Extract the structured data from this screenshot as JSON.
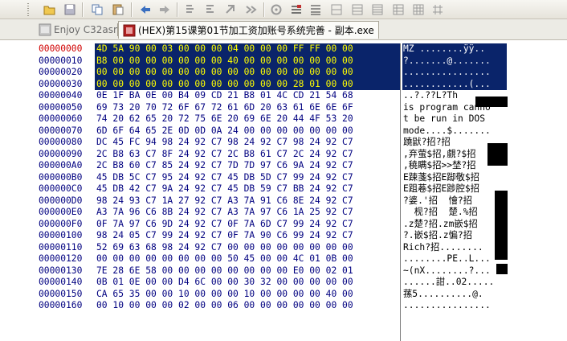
{
  "tabs": [
    {
      "label": "Enjoy C32asm"
    },
    {
      "label": "(HEX)第15课第01节加工资加账号系统完善 - 副本.exe"
    }
  ],
  "toolbar": {
    "icons": [
      "open-icon",
      "save-icon",
      "copy-icon",
      "paste-icon",
      "back-icon",
      "forward-icon",
      "jump-icon",
      "find-icon",
      "replace-icon",
      "find-next-icon",
      "goto-icon",
      "bookmark-icon",
      "column-icon",
      "split-icon",
      "grid-icon"
    ]
  },
  "hex_view": {
    "rows": [
      {
        "offset": "00000000",
        "hex": "4D 5A 90 00 03 00 00 00 04 00 00 00 FF FF 00 00",
        "ascii": "MZ ........ÿÿ..",
        "sel": true,
        "cur": true
      },
      {
        "offset": "00000010",
        "hex": "B8 00 00 00 00 00 00 00 40 00 00 00 00 00 00 00",
        "ascii": "?.......@.......",
        "sel": true
      },
      {
        "offset": "00000020",
        "hex": "00 00 00 00 00 00 00 00 00 00 00 00 00 00 00 00",
        "ascii": "................",
        "sel": true
      },
      {
        "offset": "00000030",
        "hex": "00 00 00 00 00 00 00 00 00 00 00 00 28 01 00 00",
        "ascii": "............(...",
        "sel": true
      },
      {
        "offset": "00000040",
        "hex": "0E 1F BA 0E 00 B4 09 CD 21 B8 01 4C CD 21 54 68",
        "ascii": "..?.??L?Th"
      },
      {
        "offset": "00000050",
        "hex": "69 73 20 70 72 6F 67 72 61 6D 20 63 61 6E 6E 6F",
        "ascii": "is program canno"
      },
      {
        "offset": "00000060",
        "hex": "74 20 62 65 20 72 75 6E 20 69 6E 20 44 4F 53 20",
        "ascii": "t be run in DOS "
      },
      {
        "offset": "00000070",
        "hex": "6D 6F 64 65 2E 0D 0D 0A 24 00 00 00 00 00 00 00",
        "ascii": "mode....$......."
      },
      {
        "offset": "00000080",
        "hex": "DC 45 FC 94 98 24 92 C7 98 24 92 C7 98 24 92 C7",
        "ascii": "蹺鼣?招?招"
      },
      {
        "offset": "00000090",
        "hex": "2C B8 63 C7 8F 24 92 C7 2C B8 61 C7 2C 24 92 C7",
        "ascii": ",弃萤$招,覻?$招"
      },
      {
        "offset": "000000A0",
        "hex": "2C B8 60 C7 85 24 92 C7 7D 7D 97 C6 9A 24 92 C7",
        "ascii": ",穘瞒$招>>埜?招"
      },
      {
        "offset": "000000B0",
        "hex": "45 DB 5C C7 95 24 92 C7 45 DB 5D C7 99 24 92 C7",
        "ascii": "E踈菚$招E踋敬$招"
      },
      {
        "offset": "000000C0",
        "hex": "45 DB 42 C7 9A 24 92 C7 45 DB 59 C7 BB 24 92 C7",
        "ascii": "E跙菤$招E踄腔$招"
      },
      {
        "offset": "000000D0",
        "hex": "98 24 93 C7 1A 27 92 C7 A3 7A 91 C6 8E 24 92 C7",
        "ascii": "?婆.'招  懀?招"
      },
      {
        "offset": "000000E0",
        "hex": "A3 7A 96 C6 8B 24 92 C7 A3 7A 97 C6 1A 25 92 C7",
        "ascii": "  枧?招  楚.%招"
      },
      {
        "offset": "000000F0",
        "hex": "0F 7A 97 C6 9D 24 92 C7 0F 7A 6D C7 99 24 92 C7",
        "ascii": ".z楚?招.zm嵌$招"
      },
      {
        "offset": "00000100",
        "hex": "98 24 05 C7 99 24 92 C7 0F 7A 90 C6 99 24 92 C7",
        "ascii": "?.嵌$招.z惼?招"
      },
      {
        "offset": "00000110",
        "hex": "52 69 63 68 98 24 92 C7 00 00 00 00 00 00 00 00",
        "ascii": "Rich?招........"
      },
      {
        "offset": "00000120",
        "hex": "00 00 00 00 00 00 00 00 50 45 00 00 4C 01 0B 00",
        "ascii": "........PE..L..."
      },
      {
        "offset": "00000130",
        "hex": "7E 28 6E 58 00 00 00 00 00 00 00 00 E0 00 02 01",
        "ascii": "~(nX........?..."
      },
      {
        "offset": "00000140",
        "hex": "0B 01 0E 00 00 D4 6C 00 00 30 32 00 00 00 00 00",
        "ascii": "......詌..02....."
      },
      {
        "offset": "00000150",
        "hex": "CA 65 35 00 00 10 00 00 00 10 00 00 00 00 40 00",
        "ascii": "蓀5..........@."
      },
      {
        "offset": "00000160",
        "hex": "00 10 00 00 00 02 00 00 06 00 00 00 00 00 00 00",
        "ascii": "................"
      }
    ]
  },
  "colors": {
    "offset_text": "#000080",
    "current_offset": "#d00000",
    "selection_bg": "#0a246a",
    "selection_hex_text": "#ffff00"
  }
}
